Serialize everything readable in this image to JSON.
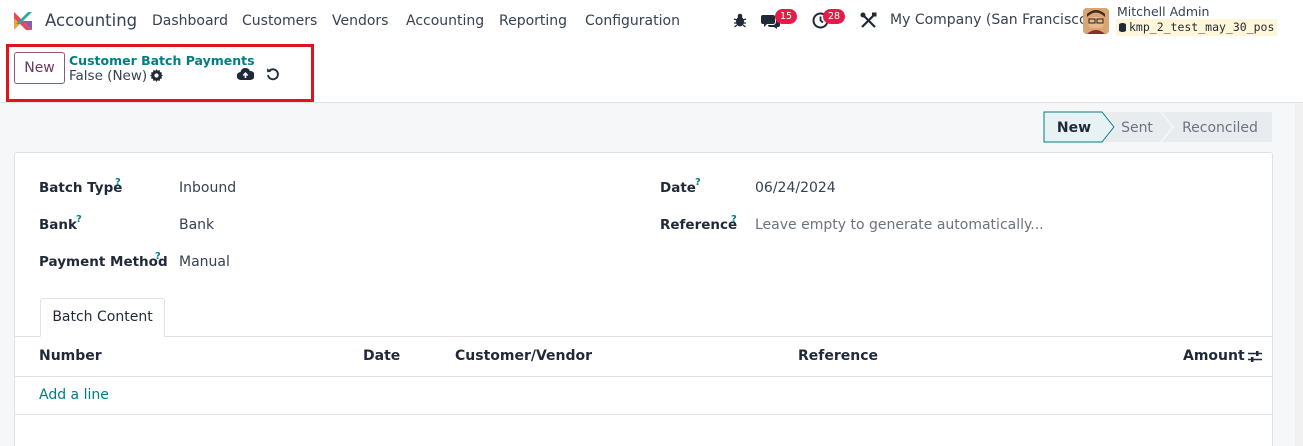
{
  "navbar": {
    "app_name": "Accounting",
    "menus": [
      "Dashboard",
      "Customers",
      "Vendors",
      "Accounting",
      "Reporting",
      "Configuration"
    ],
    "messages_count": "15",
    "activities_count": "28",
    "company": "My Company (San Francisco)",
    "user_name": "Mitchell Admin",
    "database": "kmp_2_test_may_30_pos"
  },
  "control_panel": {
    "new_label": "New",
    "breadcrumb": "Customer Batch Payments",
    "record_name": "False (New)"
  },
  "statusbar": {
    "stages": [
      "New",
      "Sent",
      "Reconciled"
    ],
    "active": "New"
  },
  "form": {
    "batch_type_label": "Batch Type",
    "batch_type_value": "Inbound",
    "bank_label": "Bank",
    "bank_value": "Bank",
    "payment_method_label": "Payment Method",
    "payment_method_value": "Manual",
    "date_label": "Date",
    "date_value": "06/24/2024",
    "reference_label": "Reference",
    "reference_placeholder": "Leave empty to generate automatically...",
    "help_mark": "?"
  },
  "tabs": {
    "batch_content": "Batch Content"
  },
  "table": {
    "columns": [
      "Number",
      "Date",
      "Customer/Vendor",
      "Reference",
      "Amount"
    ],
    "add_line": "Add a line"
  },
  "colors": {
    "accent": "#017e84",
    "brand": "#714b67",
    "highlight": "#e0141e",
    "badge": "#e11d48"
  }
}
